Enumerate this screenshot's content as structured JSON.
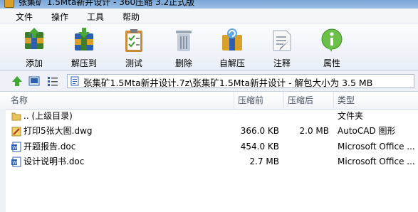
{
  "window": {
    "title": "张集矿 1.5Mta新井设计 - 360压缩 3.2正式版"
  },
  "menu": {
    "items": [
      "文件",
      "操作",
      "工具",
      "帮助"
    ]
  },
  "toolbar": {
    "buttons": [
      {
        "label": "添加",
        "icon": "add-archive-icon"
      },
      {
        "label": "解压到",
        "icon": "extract-to-icon"
      },
      {
        "label": "测试",
        "icon": "test-clipboard-icon"
      },
      {
        "label": "删除",
        "icon": "delete-trash-icon"
      },
      {
        "label": "自解压",
        "icon": "self-extract-icon"
      },
      {
        "label": "注释",
        "icon": "comment-icon"
      },
      {
        "label": "属性",
        "icon": "info-properties-icon"
      }
    ]
  },
  "address": {
    "path": "张集矿1.5Mta新井设计.7z\\张集矿1.5Mta新井设计 - 解包大小为 3.5 MB"
  },
  "columns": {
    "name": "名称",
    "before": "压缩前",
    "after": "压缩后",
    "type": "类型"
  },
  "files": [
    {
      "name": ".. (上级目录)",
      "before": "",
      "after": "",
      "type": "文件夹",
      "icon": "folder-icon"
    },
    {
      "name": "打印5张大图.dwg",
      "before": "366.0 KB",
      "after": "2.0 MB",
      "type": "AutoCAD 图形",
      "icon": "dwg-file-icon"
    },
    {
      "name": "开题报告.doc",
      "before": "454.0 KB",
      "after": "",
      "type": "Microsoft Office ...",
      "icon": "doc-file-icon"
    },
    {
      "name": "设计说明书.doc",
      "before": "2.7 MB",
      "after": "",
      "type": "Microsoft Office ...",
      "icon": "doc-file-icon"
    }
  ],
  "colors": {
    "accent": "#3b6fb6",
    "toolbar_bg": "#eef2f8"
  }
}
